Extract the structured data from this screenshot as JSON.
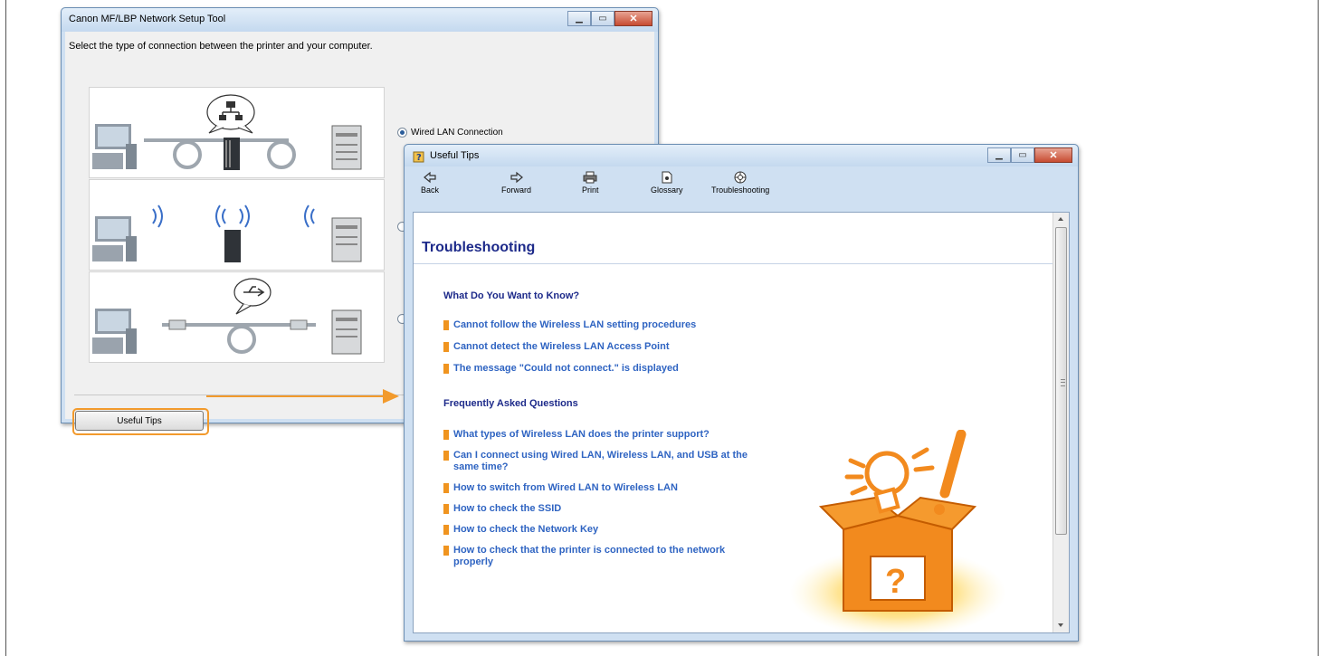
{
  "setup_window": {
    "title": "Canon MF/LBP Network Setup Tool",
    "instruction": "Select the type of connection between the printer and your computer.",
    "options": [
      {
        "label": "Wired LAN Connection",
        "selected": true
      },
      {
        "label": "",
        "selected": false
      },
      {
        "label": "",
        "selected": false
      }
    ],
    "useful_tips_button": "Useful Tips"
  },
  "tips_window": {
    "title": "Useful Tips",
    "toolbar": {
      "back": "Back",
      "forward": "Forward",
      "print": "Print",
      "glossary": "Glossary",
      "troubleshooting": "Troubleshooting"
    },
    "heading": "Troubleshooting",
    "section1": {
      "title": "What Do You Want to Know?",
      "links": [
        "Cannot follow the Wireless LAN setting procedures",
        "Cannot detect the Wireless LAN Access Point",
        "The message \"Could not connect.\" is displayed"
      ]
    },
    "section2": {
      "title": "Frequently Asked Questions",
      "links": [
        "What types of Wireless LAN does the printer support?",
        "Can I connect using Wired LAN, Wireless LAN, and USB at the same time?",
        "How to switch from Wired LAN to Wireless LAN",
        "How to check the SSID",
        "How to check the Network Key",
        "How to check that the printer is connected to the network properly"
      ]
    }
  },
  "colors": {
    "accent_orange": "#f29a2c",
    "heading_blue": "#1d2a8a",
    "link_blue": "#2f64c2"
  }
}
